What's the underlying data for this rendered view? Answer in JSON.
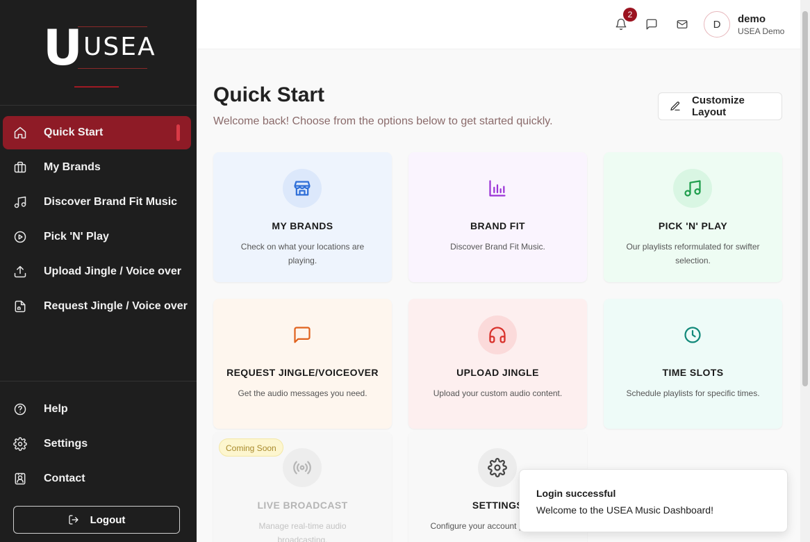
{
  "logo": {
    "letter": "U",
    "text": "USEA"
  },
  "sidebar": {
    "items": [
      {
        "label": "Quick Start",
        "icon": "home-icon",
        "active": true
      },
      {
        "label": "My Brands",
        "icon": "briefcase-icon"
      },
      {
        "label": "Discover Brand Fit Music",
        "icon": "music-icon"
      },
      {
        "label": "Pick 'N' Play",
        "icon": "play-circle-icon"
      },
      {
        "label": "Upload Jingle / Voice over",
        "icon": "upload-icon"
      },
      {
        "label": "Request Jingle / Voice over",
        "icon": "file-audio-icon"
      }
    ],
    "bottom_items": [
      {
        "label": "Help",
        "icon": "help-circle-icon"
      },
      {
        "label": "Settings",
        "icon": "gear-icon"
      },
      {
        "label": "Contact",
        "icon": "contact-icon"
      }
    ],
    "logout_label": "Logout"
  },
  "header": {
    "notification_count": "2",
    "user": {
      "initial": "D",
      "name": "demo",
      "org": "USEA Demo"
    }
  },
  "main": {
    "title": "Quick Start",
    "subtitle": "Welcome back! Choose from the options below to get started quickly.",
    "customize_label": "Customize Layout",
    "cards": [
      {
        "title": "MY BRANDS",
        "desc": "Check on what your locations are playing.",
        "icon": "store-icon",
        "bg": "#eef4fd",
        "icon_bg": "#dce8fb",
        "icon_color": "#2f6fd8"
      },
      {
        "title": "BRAND FIT",
        "desc": "Discover Brand Fit Music.",
        "icon": "bar-chart-icon",
        "bg": "#faf4fe",
        "icon_bg": "#faf4fe",
        "icon_color": "#9a33d6"
      },
      {
        "title": "PICK 'N' PLAY",
        "desc": "Our playlists reformulated for swifter selection.",
        "icon": "music-note-icon",
        "bg": "#eefcf3",
        "icon_bg": "#d9f6e3",
        "icon_color": "#1e9d4c"
      },
      {
        "title": "REQUEST JINGLE/VOICEOVER",
        "desc": "Get the audio messages you need.",
        "icon": "message-square-icon",
        "bg": "#fef6ee",
        "icon_bg": "#fef6ee",
        "icon_color": "#e0621d"
      },
      {
        "title": "UPLOAD JINGLE",
        "desc": "Upload your custom audio content.",
        "icon": "headphones-icon",
        "bg": "#fdefef",
        "icon_bg": "#fbdada",
        "icon_color": "#d8302a"
      },
      {
        "title": "TIME SLOTS",
        "desc": "Schedule playlists for specific times.",
        "icon": "clock-icon",
        "bg": "#eefbf8",
        "icon_bg": "#eefbf8",
        "icon_color": "#12897a"
      },
      {
        "title": "LIVE BROADCAST",
        "desc": "Manage real-time audio broadcasting.",
        "icon": "broadcast-icon",
        "bg": "#f7f7f7",
        "icon_bg": "#ededed",
        "icon_color": "#b5b5b5",
        "badge": "Coming Soon"
      },
      {
        "title": "SETTINGS",
        "desc": "Configure your account preferences.",
        "icon": "gear-icon",
        "bg": "#f8f8f8",
        "icon_bg": "#ececec",
        "icon_color": "#444444"
      }
    ]
  },
  "toast": {
    "title": "Login successful",
    "message": "Welcome to the USEA Music Dashboard!"
  },
  "colors": {
    "brand_red": "#8e1b26",
    "sidebar_bg": "#1e1e1e"
  }
}
